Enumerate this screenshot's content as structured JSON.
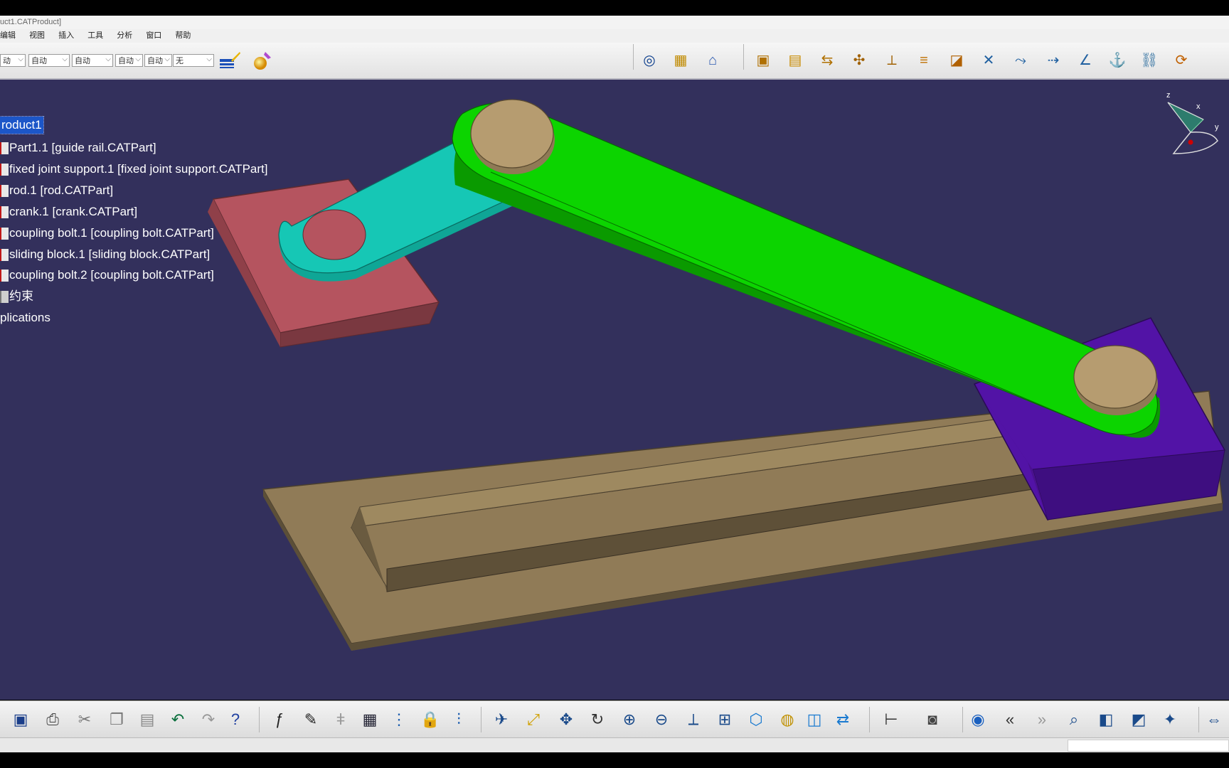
{
  "window": {
    "title": "uct1.CATProduct]"
  },
  "menu": [
    "编辑",
    "视图",
    "插入",
    "工具",
    "分析",
    "窗口",
    "帮助"
  ],
  "top_toolbar": {
    "dropdowns": [
      "动",
      "自动",
      "自动",
      "自动",
      "自动",
      "无"
    ],
    "left_icons": [
      "paint-brush-icon",
      "material-sphere-icon"
    ],
    "right_icons": [
      "swirl-icon",
      "catalog-icon",
      "product-icon",
      "component-icon",
      "existing-component-icon",
      "replace-component-icon",
      "graph-tree-icon",
      "symmetry-icon",
      "fast-multi-instantiation-icon",
      "sectioning-icon",
      "coincidence-constraint-icon",
      "contact-constraint-icon",
      "offset-constraint-icon",
      "angle-constraint-icon",
      "fix-component-icon",
      "fix-together-icon",
      "update-icon"
    ]
  },
  "tree": {
    "root": "roduct1",
    "items": [
      "Part1.1 [guide rail.CATPart]",
      "fixed joint support.1 [fixed joint support.CATPart]",
      "rod.1 [rod.CATPart]",
      "crank.1 [crank.CATPart]",
      "coupling bolt.1 [coupling bolt.CATPart]",
      "sliding block.1 [sliding block.CATPart]",
      "coupling bolt.2 [coupling bolt.CATPart]",
      "约束",
      "plications"
    ]
  },
  "compass": {
    "x": "x",
    "y": "y",
    "z": "z"
  },
  "bottom_toolbar": {
    "icons": [
      "save-icon",
      "print-icon",
      "cut-icon",
      "copy-icon",
      "paste-icon",
      "undo-icon",
      "redo-icon",
      "whats-this-icon",
      "formula-icon",
      "annotation-icon",
      "knowledge-icon",
      "table-icon",
      "graph-icon",
      "lock-icon",
      "parameters-icon",
      "fly-mode-icon",
      "fit-all-icon",
      "pan-icon",
      "rotate-icon",
      "zoom-in-icon",
      "zoom-out-icon",
      "normal-view-icon",
      "multi-view-icon",
      "iso-view-icon",
      "shading-icon",
      "hide-show-icon",
      "swap-space-icon",
      "measure-icon",
      "capture-icon",
      "target-icon",
      "previous-icon",
      "next-icon",
      "magnifier-icon",
      "sectioning-view-icon",
      "fog-icon",
      "light-icon",
      "scale-icon"
    ]
  },
  "colors": {
    "viewport_bg": "#33305c",
    "rod": "#0cd400",
    "crank": "#16c7b5",
    "support": "#b5545f",
    "rail": "#907b57",
    "block": "#5213a6",
    "bolt": "#b69c70"
  }
}
